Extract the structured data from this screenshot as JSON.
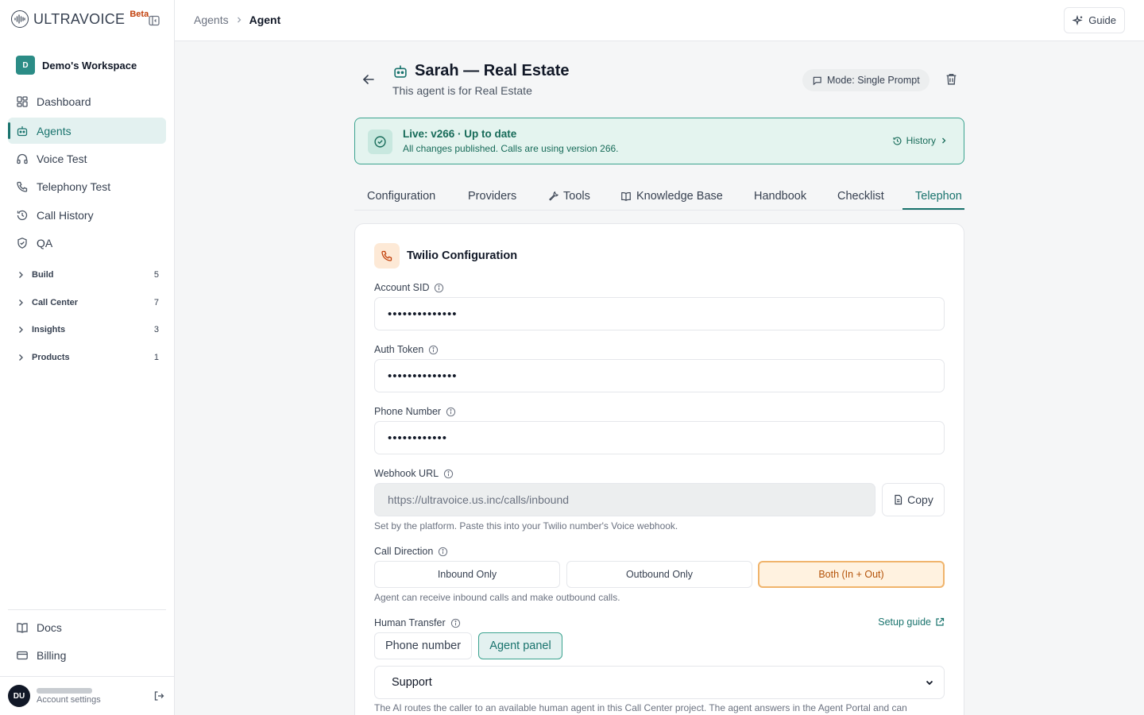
{
  "brand": {
    "name": "ULTRAVOICE",
    "badge": "Beta"
  },
  "workspace": {
    "initial": "D",
    "name": "Demo's Workspace"
  },
  "nav": {
    "items": [
      {
        "label": "Dashboard",
        "icon": "dashboard-icon",
        "active": false
      },
      {
        "label": "Agents",
        "icon": "bot-icon",
        "active": true
      },
      {
        "label": "Voice Test",
        "icon": "headphones-icon",
        "active": false
      },
      {
        "label": "Telephony Test",
        "icon": "phone-icon",
        "active": false
      },
      {
        "label": "Call History",
        "icon": "history-icon",
        "active": false
      },
      {
        "label": "QA",
        "icon": "shield-check-icon",
        "active": false
      }
    ],
    "groups": [
      {
        "label": "Build",
        "count": "5"
      },
      {
        "label": "Call Center",
        "count": "7"
      },
      {
        "label": "Insights",
        "count": "3"
      },
      {
        "label": "Products",
        "count": "1"
      }
    ],
    "footer": [
      {
        "label": "Docs",
        "icon": "book-icon"
      },
      {
        "label": "Billing",
        "icon": "credit-card-icon"
      }
    ]
  },
  "user": {
    "initials": "DU",
    "subtitle": "Account settings"
  },
  "topbar": {
    "breadcrumb": [
      "Agents",
      "Agent"
    ],
    "guide_label": "Guide"
  },
  "agent": {
    "name": "Sarah — Real Estate",
    "description": "This agent is for Real Estate",
    "mode_label": "Mode: Single Prompt"
  },
  "live": {
    "title": "Live: v266 · Up to date",
    "description": "All changes published. Calls are using version 266.",
    "history_label": "History"
  },
  "tabs": [
    {
      "label": "Configuration",
      "icon": ""
    },
    {
      "label": "Providers",
      "icon": ""
    },
    {
      "label": "Tools",
      "icon": "wrench-icon"
    },
    {
      "label": "Knowledge Base",
      "icon": "book-open-icon"
    },
    {
      "label": "Handbook",
      "icon": ""
    },
    {
      "label": "Checklist",
      "icon": ""
    },
    {
      "label": "Telephon",
      "icon": "",
      "active": true
    }
  ],
  "twilio": {
    "title": "Twilio Configuration",
    "account_sid": {
      "label": "Account SID",
      "value": "••••••••••••••"
    },
    "auth_token": {
      "label": "Auth Token",
      "value": "••••••••••••••"
    },
    "phone_number": {
      "label": "Phone Number",
      "value": "••••••••••••"
    },
    "webhook": {
      "label": "Webhook URL",
      "value": "https://ultravoice.us.inc/calls/inbound",
      "copy_label": "Copy",
      "help": "Set by the platform. Paste this into your Twilio number's Voice webhook."
    },
    "call_direction": {
      "label": "Call Direction",
      "options": [
        "Inbound Only",
        "Outbound Only",
        "Both (In + Out)"
      ],
      "selected": "Both (In + Out)",
      "help": "Agent can receive inbound calls and make outbound calls."
    },
    "human_transfer": {
      "label": "Human Transfer",
      "setup_guide_label": "Setup guide",
      "options": [
        "Phone number",
        "Agent panel"
      ],
      "selected": "Agent panel",
      "project_value": "Support",
      "note": "The AI routes the caller to an available human agent in this Call Center project. The agent answers in the Agent Portal and can"
    }
  }
}
